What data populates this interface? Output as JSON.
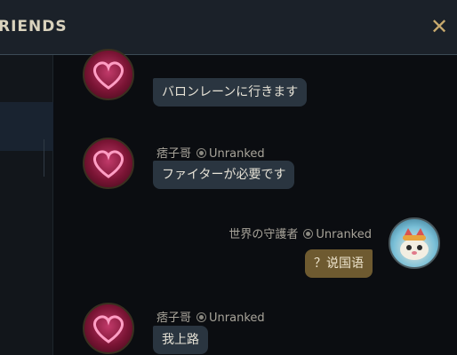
{
  "header": {
    "title": "RIENDS",
    "close_icon": "close-icon"
  },
  "colors": {
    "accent_gold": "#c8aa6e",
    "incoming_bubble": "#2a3540",
    "outgoing_bubble": "#6e5a30"
  },
  "messages": [
    {
      "sender": "",
      "status": "",
      "text": "バロンレーンに行きます",
      "direction": "incoming"
    },
    {
      "sender": "痞子哥",
      "status": "Unranked",
      "text": "ファイターが必要です",
      "direction": "incoming"
    },
    {
      "sender": "世界の守護者",
      "status": "Unranked",
      "text": "？说国语",
      "direction": "outgoing"
    },
    {
      "sender": "痞子哥",
      "status": "Unranked",
      "text": "我上路",
      "direction": "incoming"
    }
  ]
}
